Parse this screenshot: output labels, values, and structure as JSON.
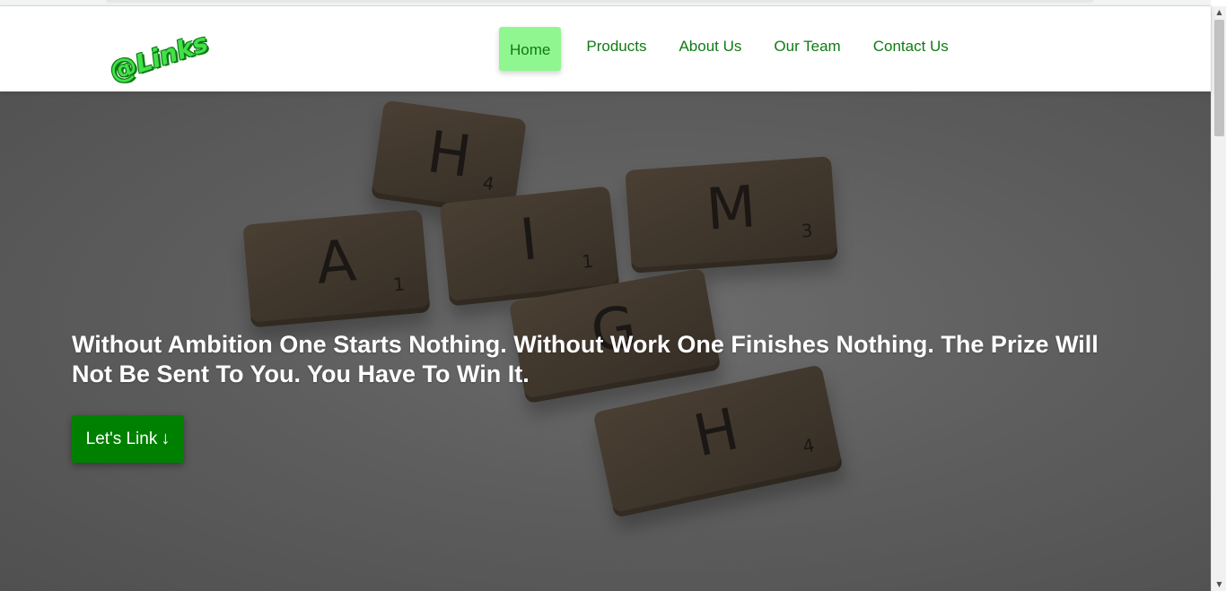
{
  "brand": {
    "logo_mark": "@",
    "logo_text": "Links"
  },
  "nav": {
    "items": [
      {
        "label": "Home",
        "active": true
      },
      {
        "label": "Products",
        "active": false
      },
      {
        "label": "About Us",
        "active": false
      },
      {
        "label": "Our Team",
        "active": false
      },
      {
        "label": "Contact Us",
        "active": false
      }
    ]
  },
  "hero": {
    "quote": "Without Ambition One Starts Nothing. Without Work One Finishes Nothing. The Prize Will Not Be Sent To You. You Have To Win It.",
    "cta_label": "Let's Link",
    "cta_icon": "↓",
    "tiles": [
      {
        "letter": "H",
        "number": "4"
      },
      {
        "letter": "A",
        "number": "1"
      },
      {
        "letter": "I",
        "number": "1"
      },
      {
        "letter": "M",
        "number": "3"
      },
      {
        "letter": "G",
        "number": ""
      },
      {
        "letter": "H",
        "number": "4"
      }
    ]
  },
  "colors": {
    "nav_text": "#0f7a14",
    "nav_active_bg": "#90f790",
    "cta_bg": "#008000",
    "logo_green": "#43e04a"
  },
  "scrollbar": {
    "up": "▲",
    "down": "▼"
  }
}
